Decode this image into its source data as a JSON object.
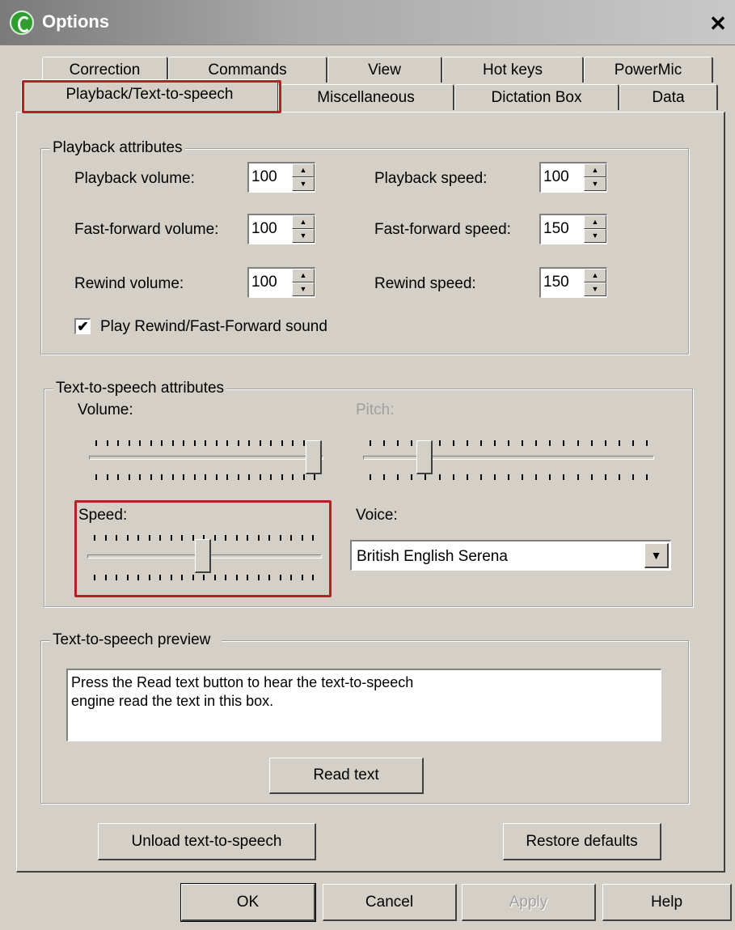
{
  "window": {
    "title": "Options",
    "close_glyph": "✕"
  },
  "tabs": {
    "row1": [
      "Correction",
      "Commands",
      "View",
      "Hot keys",
      "PowerMic"
    ],
    "row2": [
      "Playback/Text-to-speech",
      "Miscellaneous",
      "Dictation Box",
      "Data"
    ],
    "active": "Playback/Text-to-speech"
  },
  "playback": {
    "group_title": "Playback attributes",
    "playback_volume": {
      "label": "Playback volume:",
      "value": "100"
    },
    "fastforward_volume": {
      "label": "Fast-forward volume:",
      "value": "100"
    },
    "rewind_volume": {
      "label": "Rewind volume:",
      "value": "100"
    },
    "playback_speed": {
      "label": "Playback speed:",
      "value": "100"
    },
    "fastforward_speed": {
      "label": "Fast-forward speed:",
      "value": "150"
    },
    "rewind_speed": {
      "label": "Rewind speed:",
      "value": "150"
    },
    "sound_checkbox": {
      "label": "Play Rewind/Fast-Forward sound",
      "checked": true,
      "mark": "✔"
    }
  },
  "tts": {
    "group_title": "Text-to-speech attributes",
    "volume": {
      "label": "Volume:",
      "level": 1.0
    },
    "pitch": {
      "label": "Pitch:",
      "level": 0.2,
      "enabled": false
    },
    "speed": {
      "label": "Speed:",
      "level": 0.5
    },
    "voice": {
      "label": "Voice:",
      "value": "British English Serena",
      "arrow": "▼"
    }
  },
  "preview": {
    "group_title": "Text-to-speech preview",
    "text": "Press the Read text button to hear the text-to-speech\nengine read the text in this box.",
    "read_button": "Read text"
  },
  "actions": {
    "unload": "Unload text-to-speech",
    "restore": "Restore defaults"
  },
  "dialog_buttons": {
    "ok": "OK",
    "cancel": "Cancel",
    "apply": "Apply",
    "help": "Help"
  },
  "colors": {
    "highlight": "#b22222",
    "dialog_bg": "#d4d0c8"
  }
}
